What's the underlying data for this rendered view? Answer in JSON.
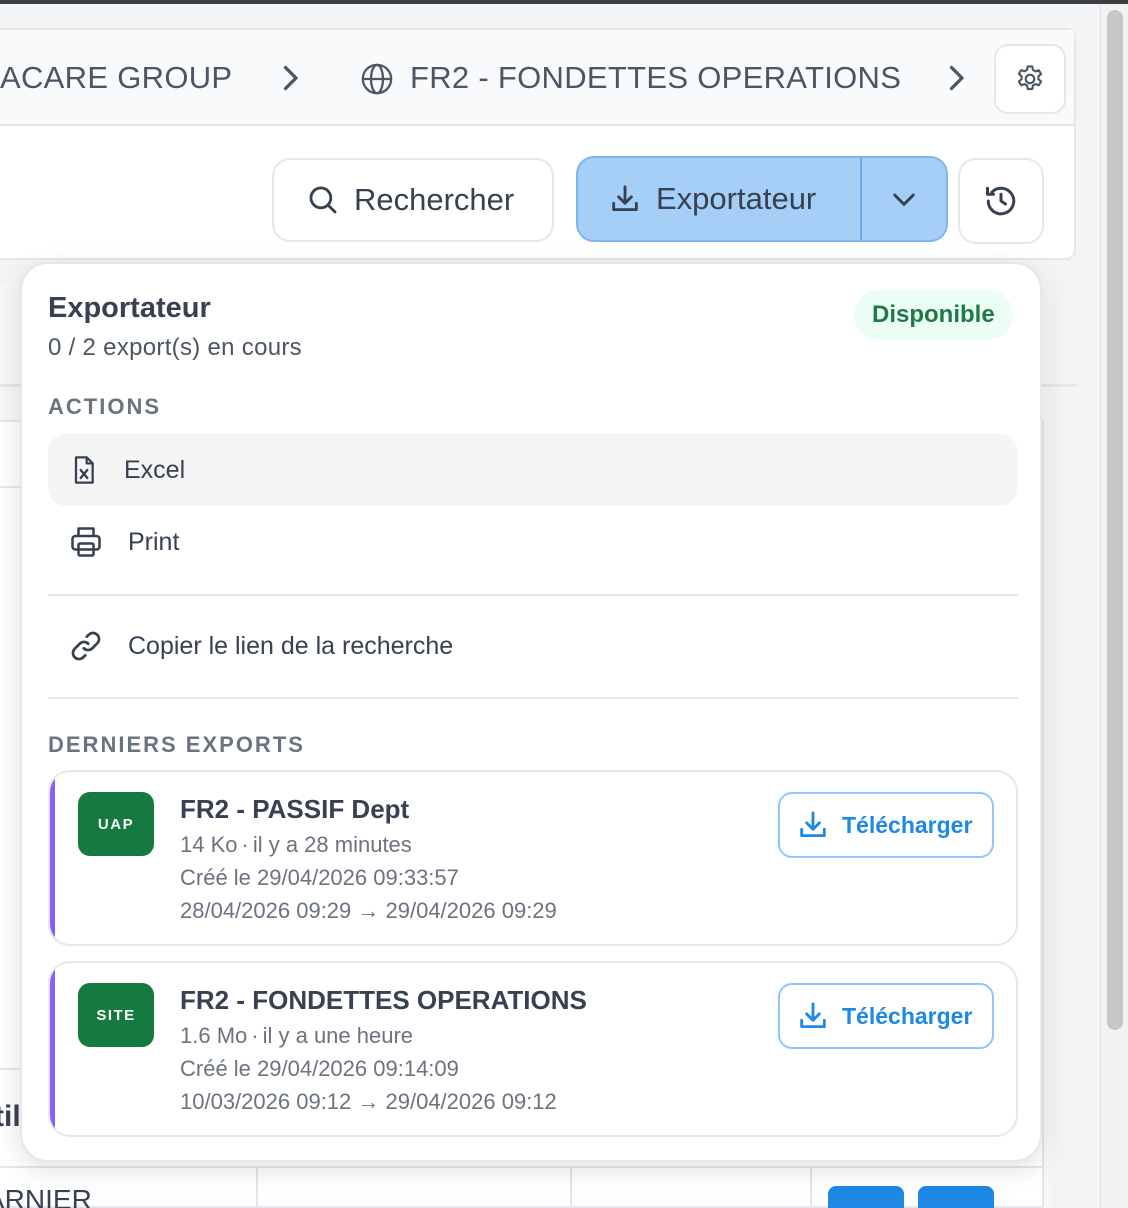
{
  "breadcrumb": {
    "items": [
      "ACARE GROUP",
      "FR2 - FONDETTES OPERATIONS"
    ]
  },
  "toolbar": {
    "search_label": "Rechercher",
    "export_label": "Exportateur"
  },
  "background": {
    "partial_text_1": "ARNIER",
    "partial_text_2": "til"
  },
  "exporter": {
    "title": "Exportateur",
    "subtitle": "0 / 2 export(s) en cours",
    "status": "Disponible",
    "actions_title": "ACTIONS",
    "actions": [
      {
        "label": "Excel",
        "icon": "excel-file-icon"
      },
      {
        "label": "Print",
        "icon": "printer-icon"
      }
    ],
    "copy_link_label": "Copier le lien de la recherche",
    "recent_title": "DERNIERS EXPORTS",
    "recent": [
      {
        "badge": "UAP",
        "name": "FR2 - PASSIF Dept",
        "size": "14 Ko",
        "age": "il y a 28 minutes",
        "created": "Créé le 29/04/2026 09:33:57",
        "range": "28/04/2026 09:29 → 29/04/2026 09:29",
        "download_label": "Télécharger"
      },
      {
        "badge": "SITE",
        "name": "FR2 - FONDETTES OPERATIONS",
        "size": "1.6 Mo",
        "age": "il y a une heure",
        "created": "Créé le 29/04/2026 09:14:09",
        "range": "10/03/2026 09:12 → 29/04/2026 09:12",
        "download_label": "Télécharger"
      }
    ]
  },
  "colors": {
    "accent_purple": "#8b5cf6",
    "badge_green": "#157a3f",
    "link_blue": "#1e88e5",
    "export_button_bg": "#a5cff6",
    "status_green": "#1f7a4a"
  }
}
